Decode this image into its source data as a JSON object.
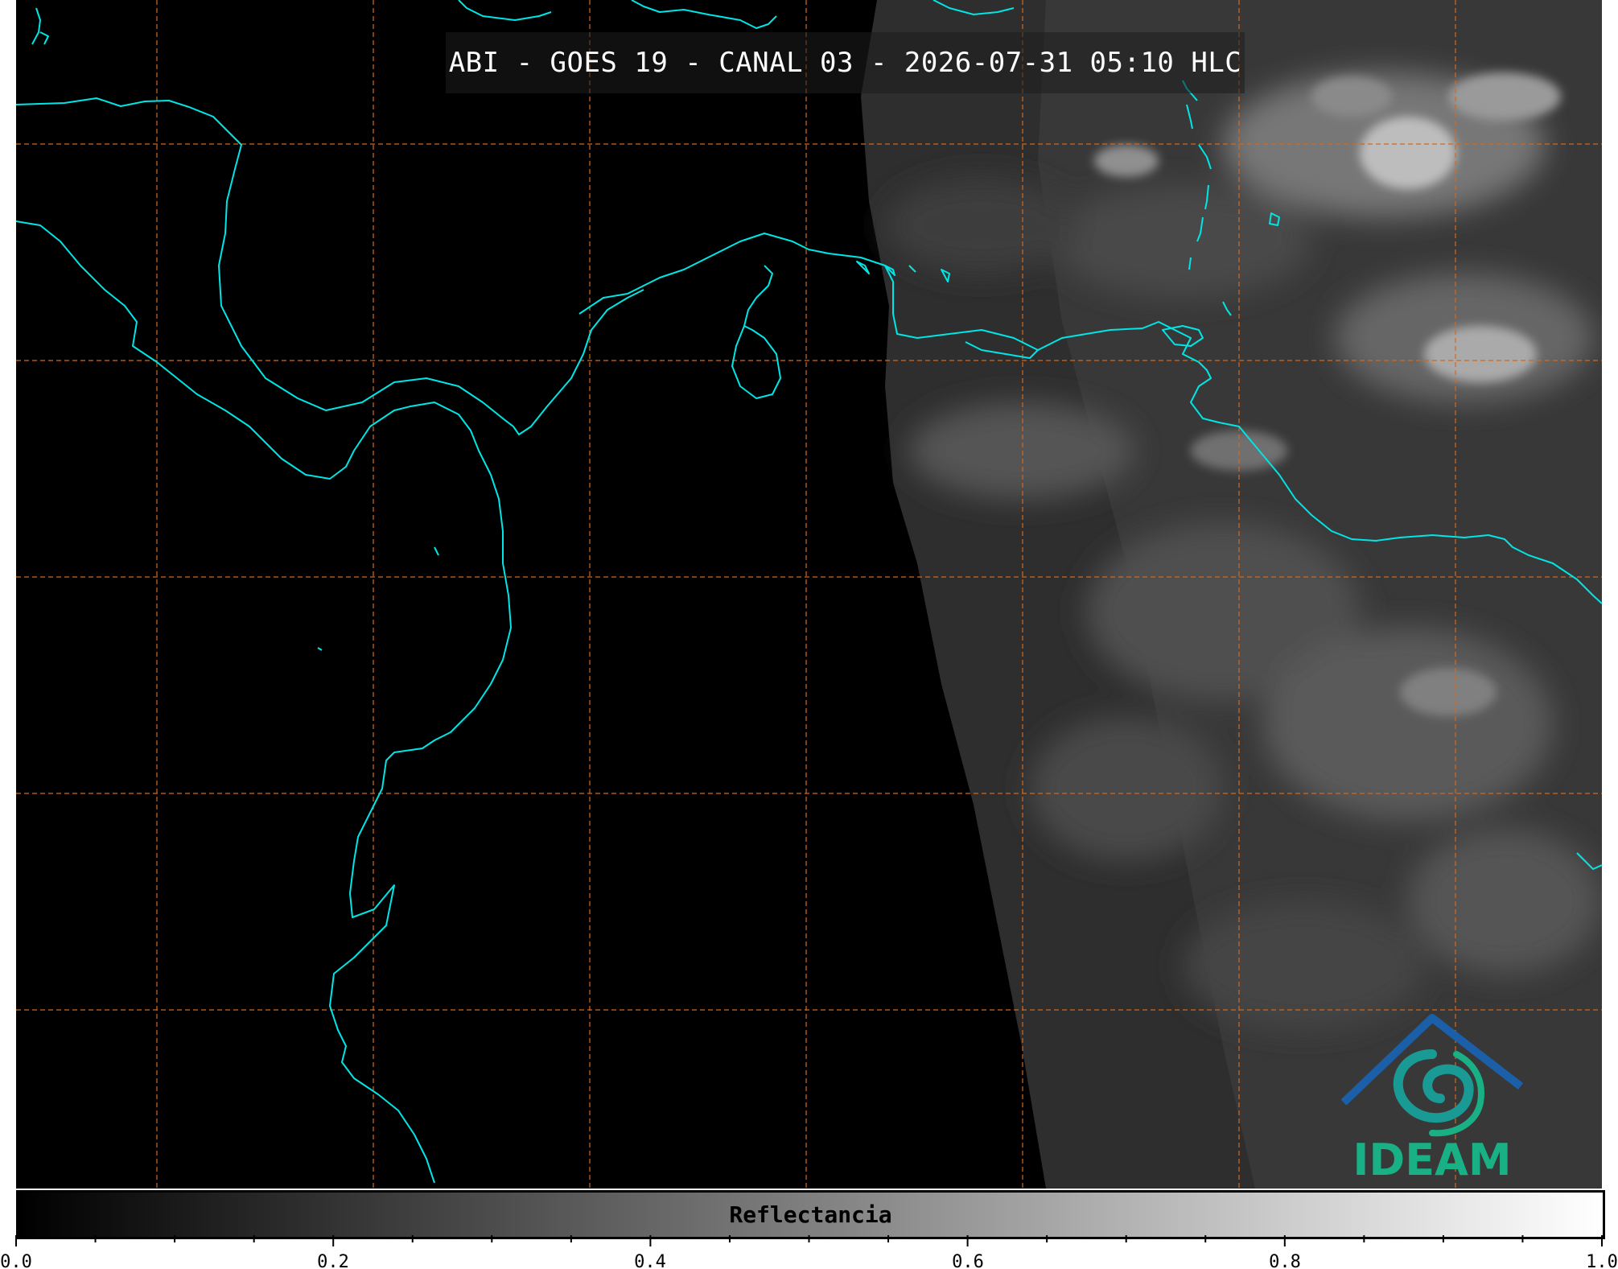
{
  "title": "ABI - GOES 19 - CANAL 03 - 2026-07-31 05:10 HLC",
  "colorbar": {
    "label": "Reflectancia",
    "min": 0.0,
    "max": 1.0,
    "tick_labels": [
      "0.0",
      "0.2",
      "0.4",
      "0.6",
      "0.8",
      "1.0"
    ],
    "minor_step": 0.05
  },
  "logo": {
    "text": "IDEAM",
    "color_dark": "#1b5fa8",
    "color_light": "#1ab085"
  },
  "colors": {
    "coastline": "#00e5e5",
    "graticule": "#d2691e",
    "background": "#000000"
  }
}
